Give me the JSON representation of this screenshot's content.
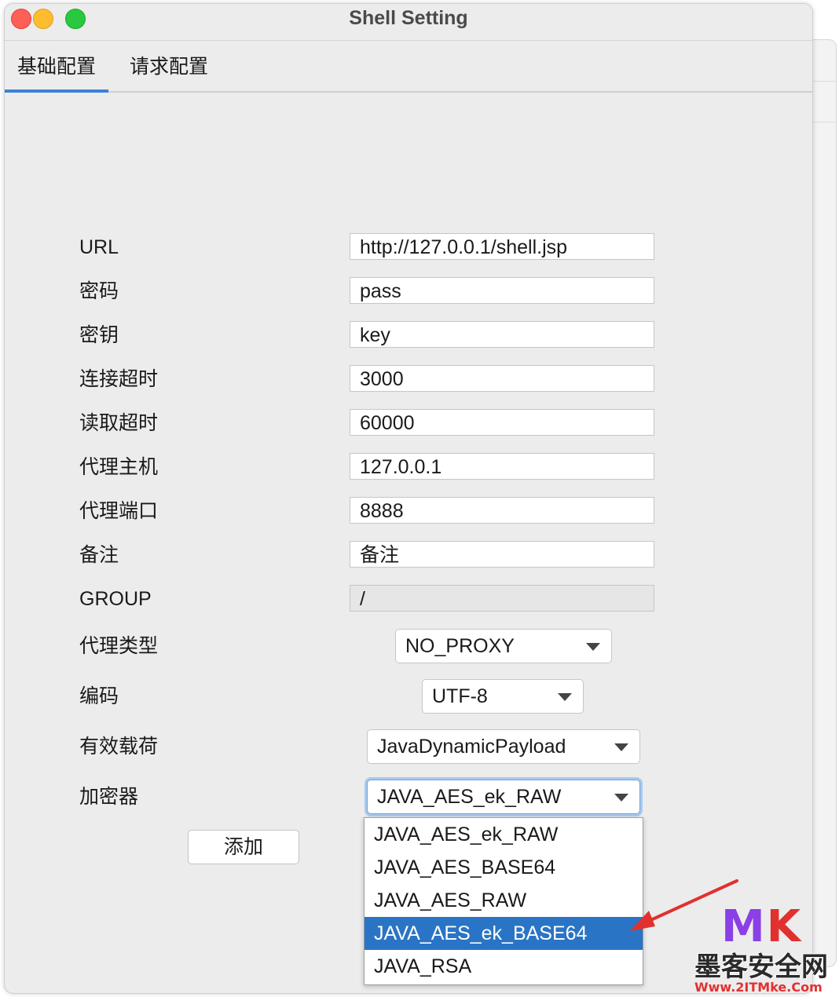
{
  "window": {
    "title": "Shell Setting"
  },
  "tabs": [
    {
      "label": "基础配置",
      "active": true
    },
    {
      "label": "请求配置",
      "active": false
    }
  ],
  "form": {
    "url": {
      "label": "URL",
      "value": "http://127.0.0.1/shell.jsp"
    },
    "password": {
      "label": "密码",
      "value": "pass"
    },
    "key": {
      "label": "密钥",
      "value": "key"
    },
    "connect_timeout": {
      "label": "连接超时",
      "value": "3000"
    },
    "read_timeout": {
      "label": "读取超时",
      "value": "60000"
    },
    "proxy_host": {
      "label": "代理主机",
      "value": "127.0.0.1"
    },
    "proxy_port": {
      "label": "代理端口",
      "value": "8888"
    },
    "remark": {
      "label": "备注",
      "value": "备注"
    },
    "group": {
      "label": "GROUP",
      "value": "/"
    },
    "proxy_type": {
      "label": "代理类型",
      "value": "NO_PROXY"
    },
    "encoding": {
      "label": "编码",
      "value": "UTF-8"
    },
    "payload": {
      "label": "有效载荷",
      "value": "JavaDynamicPayload"
    },
    "cryption": {
      "label": "加密器",
      "value": "JAVA_AES_ek_RAW"
    }
  },
  "add_button": {
    "label": "添加"
  },
  "cryption_dropdown": {
    "options": [
      "JAVA_AES_ek_RAW",
      "JAVA_AES_BASE64",
      "JAVA_AES_RAW",
      "JAVA_AES_ek_BASE64",
      "JAVA_RSA"
    ],
    "highlighted": "JAVA_AES_ek_BASE64"
  },
  "colors": {
    "accent": "#3b82d6",
    "selection": "#2a74c5",
    "annotation_arrow": "#e0312f"
  },
  "watermark": {
    "logo_m": "M",
    "logo_k": "K",
    "site_name": "墨客安全网",
    "url": "Www.2ITMke.Com"
  }
}
